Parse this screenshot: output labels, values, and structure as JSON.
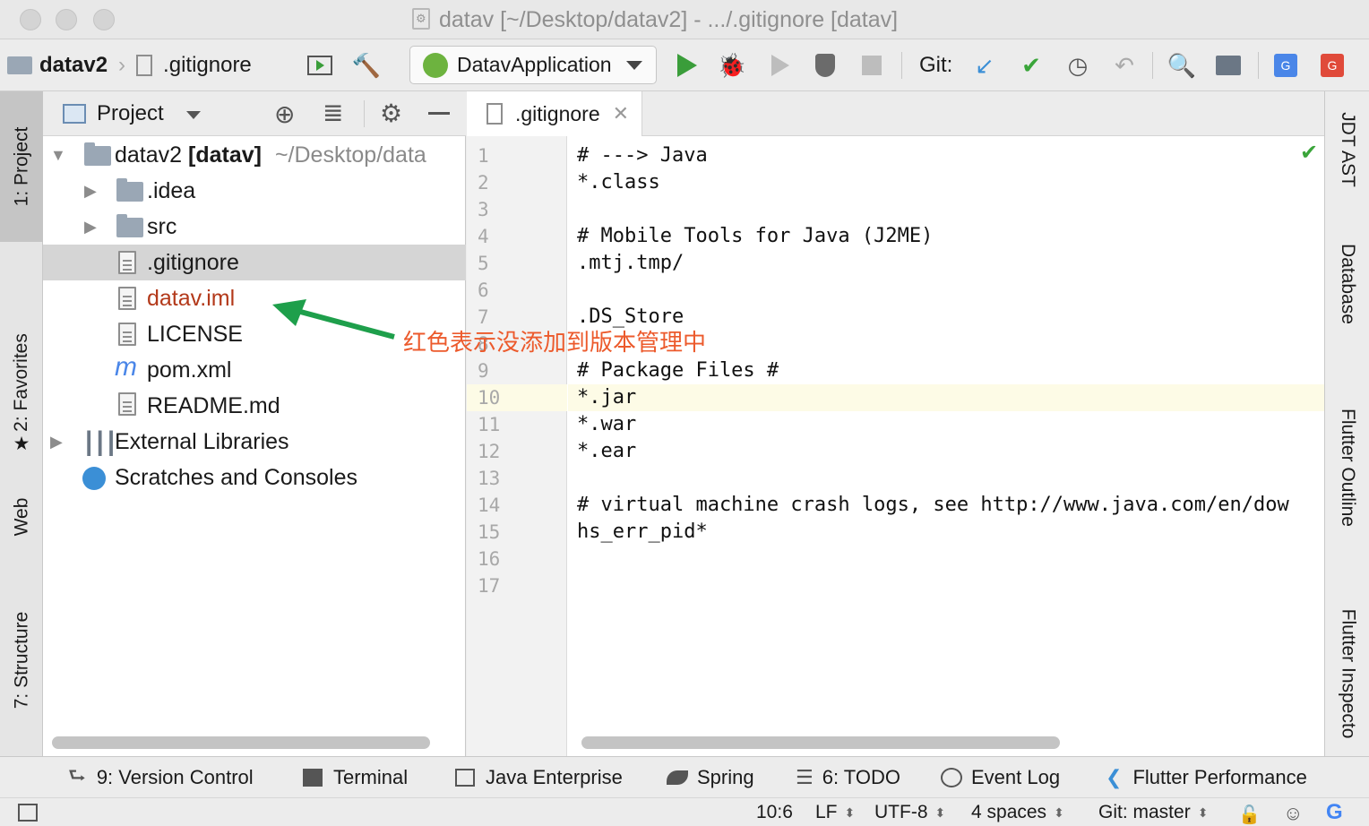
{
  "window": {
    "title": "datav [~/Desktop/datav2] - .../.gitignore [datav]"
  },
  "toolbar": {
    "breadcrumb_project": "datav2",
    "breadcrumb_file": ".gitignore",
    "run_config": "DatavApplication",
    "git_label": "Git:"
  },
  "left_tabs": {
    "project": "1: Project",
    "favorites": "2: Favorites",
    "web": "Web",
    "structure": "7: Structure"
  },
  "right_tabs": {
    "jdt_ast": "JDT AST",
    "database": "Database",
    "flutter_outline": "Flutter Outline",
    "flutter_inspector": "Flutter Inspecto"
  },
  "project_panel": {
    "title": "Project",
    "tree": [
      {
        "label": "datav2",
        "bold_suffix": "[datav]",
        "path": "~/Desktop/data"
      },
      {
        "label": ".idea"
      },
      {
        "label": "src"
      },
      {
        "label": ".gitignore"
      },
      {
        "label": "datav.iml"
      },
      {
        "label": "LICENSE"
      },
      {
        "label": "pom.xml"
      },
      {
        "label": "README.md"
      },
      {
        "label": "External Libraries"
      },
      {
        "label": "Scratches and Consoles"
      }
    ]
  },
  "annotation": {
    "text": "红色表示没添加到版本管理中",
    "color": "#ec5a2c",
    "arrow_color": "#1e9f4b"
  },
  "editor": {
    "tab_label": ".gitignore",
    "current_line": 10,
    "lines": [
      "# ---> Java",
      "*.class",
      "",
      "# Mobile Tools for Java (J2ME)",
      ".mtj.tmp/",
      "",
      ".DS_Store",
      "",
      "# Package Files #",
      "*.jar",
      "*.war",
      "*.ear",
      "",
      "# virtual machine crash logs, see http://www.java.com/en/dow",
      "hs_err_pid*",
      "",
      ""
    ],
    "line_numbers": [
      "1",
      "2",
      "3",
      "4",
      "5",
      "6",
      "7",
      "8",
      "9",
      "10",
      "11",
      "12",
      "13",
      "14",
      "15",
      "16",
      "17"
    ]
  },
  "bottom_tools": {
    "version_control": "9: Version Control",
    "terminal": "Terminal",
    "java_enterprise": "Java Enterprise",
    "spring": "Spring",
    "todo": "6: TODO",
    "event_log": "Event Log",
    "flutter_performance": "Flutter Performance"
  },
  "status": {
    "position": "10:6",
    "line_sep": "LF",
    "encoding": "UTF-8",
    "indent": "4 spaces",
    "git_branch": "Git: master"
  },
  "colors": {
    "unversioned_file": "#b3391a",
    "run_green": "#3a9d3a",
    "git_blue": "#3b8fd6",
    "git_check": "#3aa53a"
  }
}
